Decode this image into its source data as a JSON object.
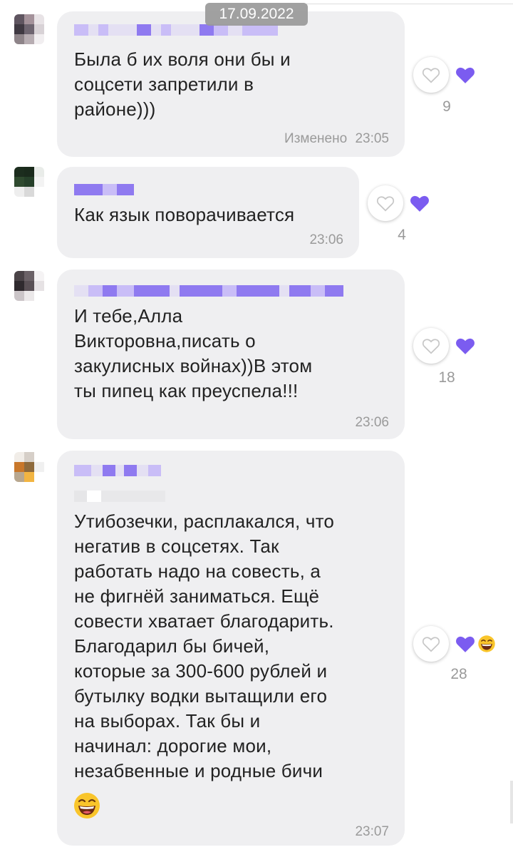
{
  "date_separator": "17.09.2022",
  "accent_color": "#7b5cf0",
  "messages": [
    {
      "text": "Была б их воля они бы и\nсоцсети запретили в\nрайоне)))",
      "edited_label": "Изменено",
      "time": "23:05",
      "likes": "9",
      "reactions": [
        "heart-outline-icon",
        "heart-filled-icon"
      ]
    },
    {
      "text": "Как язык поворачивается",
      "time": "23:06",
      "likes": "4",
      "reactions": [
        "heart-outline-icon",
        "heart-filled-icon"
      ]
    },
    {
      "text": "И тебе,Алла\nВикторовна,писать о\nзакулисных войнах))В этом\nты пипец как преуспела!!!",
      "time": "23:06",
      "likes": "18",
      "reactions": [
        "heart-outline-icon",
        "heart-filled-icon"
      ]
    },
    {
      "text": "Утибозечки, расплакался, что\nнегатив в соцсетях. Так\nработать надо на совесть, а\nне фигнёй заниматься. Ещё\nсовести хватает благодарить.\nБлагодарил бы бичей,\nкоторые за 300-600 рублей и\nбутылку водки вытащили его\nна выборах. Так бы и\nначинал: дорогие мои,\nнезабвенные и родные бичи",
      "time": "23:07",
      "likes": "28",
      "reactions": [
        "heart-outline-icon",
        "heart-filled-icon",
        "laughing-emoji-icon"
      ]
    }
  ]
}
